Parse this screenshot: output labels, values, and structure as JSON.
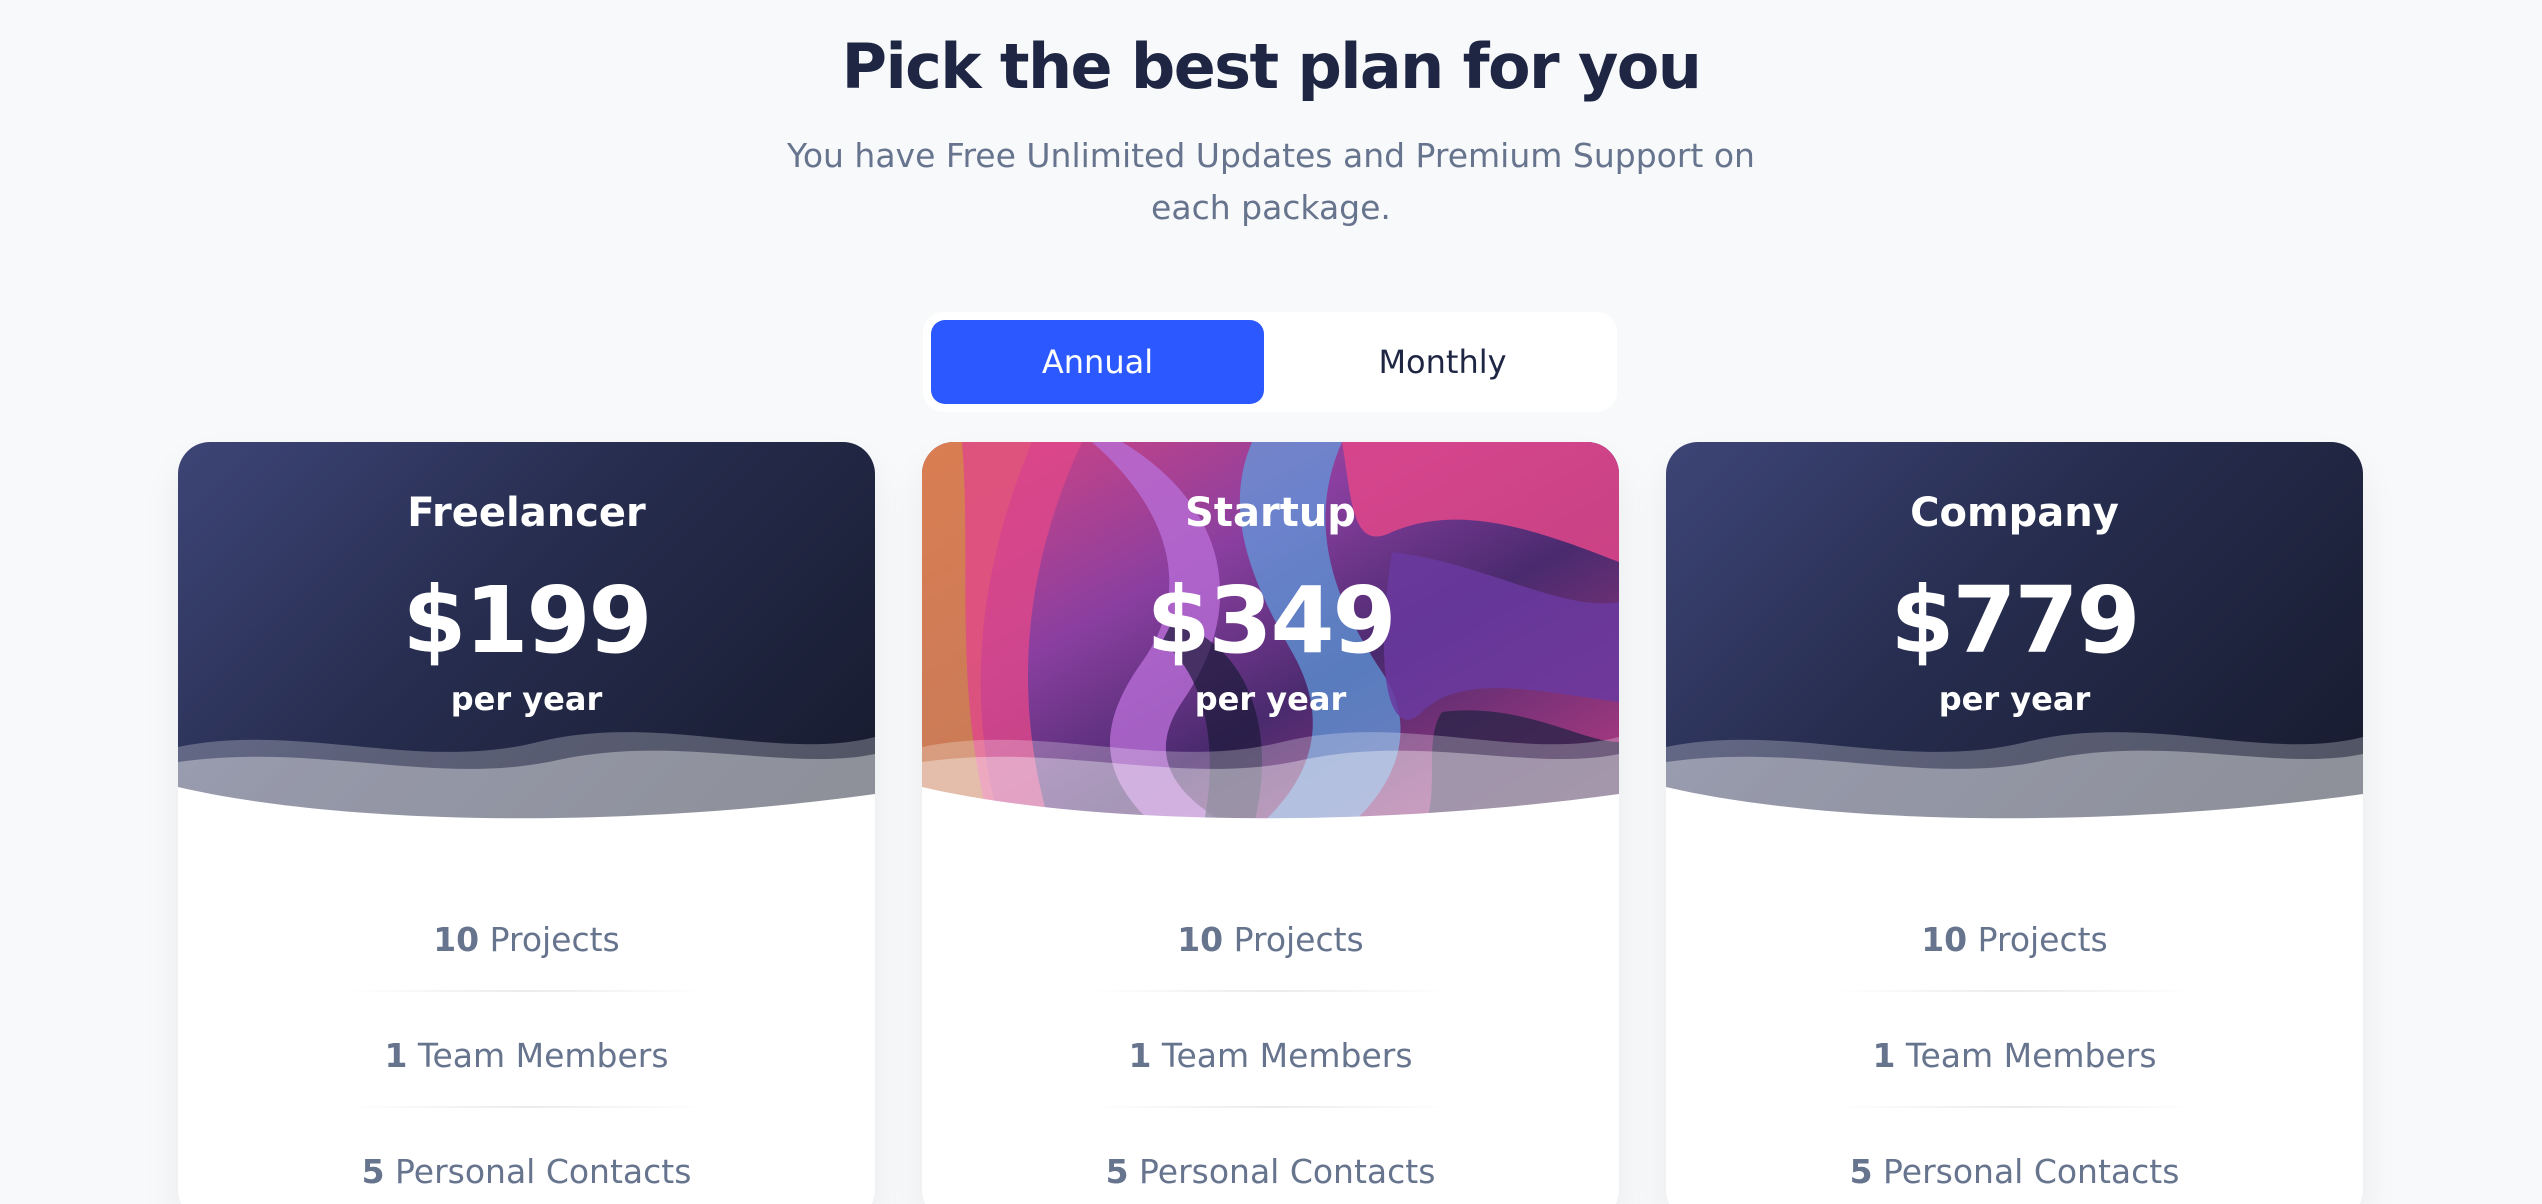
{
  "header": {
    "title": "Pick the best plan for you",
    "subtitle": "You have Free Unlimited Updates and Premium Support on each package."
  },
  "toggle": {
    "options": [
      {
        "label": "Annual",
        "active": true
      },
      {
        "label": "Monthly",
        "active": false
      }
    ]
  },
  "colors": {
    "accent": "#2c59ff",
    "heading": "#1e2643",
    "muted": "#67748e",
    "card_dark": "#262c4d"
  },
  "plans": [
    {
      "name": "Freelancer",
      "price": "$199",
      "period": "per year",
      "features": [
        {
          "value": "10",
          "label": "Projects"
        },
        {
          "value": "1",
          "label": "Team Members"
        },
        {
          "value": "5",
          "label": "Personal Contacts"
        }
      ]
    },
    {
      "name": "Startup",
      "price": "$349",
      "period": "per year",
      "features": [
        {
          "value": "10",
          "label": "Projects"
        },
        {
          "value": "1",
          "label": "Team Members"
        },
        {
          "value": "5",
          "label": "Personal Contacts"
        }
      ]
    },
    {
      "name": "Company",
      "price": "$779",
      "period": "per year",
      "features": [
        {
          "value": "10",
          "label": "Projects"
        },
        {
          "value": "1",
          "label": "Team Members"
        },
        {
          "value": "5",
          "label": "Personal Contacts"
        }
      ]
    }
  ]
}
